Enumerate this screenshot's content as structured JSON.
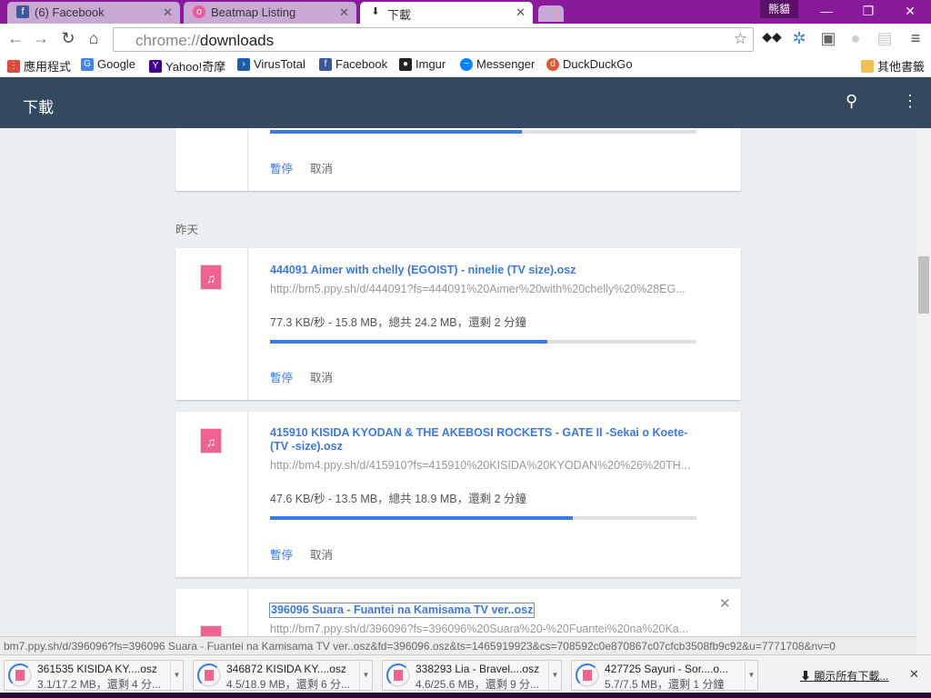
{
  "tabs": [
    {
      "label": "(6) Facebook",
      "icon": "facebook-icon"
    },
    {
      "label": "Beatmap Listing",
      "icon": "osu-icon"
    },
    {
      "label": "下載",
      "icon": "download-icon",
      "active": true
    }
  ],
  "profile": "熊貓",
  "omnibox": {
    "scheme": "chrome://",
    "path": "downloads"
  },
  "bookmarks": [
    "應用程式",
    "Google",
    "Yahoo!奇摩",
    "VirusTotal",
    "Facebook",
    "Imgur",
    "Messenger",
    "DuckDuckGo"
  ],
  "other_bookmarks": "其他書籤",
  "header": {
    "title": "下載"
  },
  "date_label": "昨天",
  "actions": {
    "pause": "暫停",
    "cancel": "取消"
  },
  "downloads": [
    {
      "progress": 0.59
    },
    {
      "name": "444091 Aimer with chelly (EGOIST) - ninelie (TV size).osz",
      "url": "http://bm5.ppy.sh/d/444091?fs=444091%20Aimer%20with%20chelly%20%28EG...",
      "desc": "77.3 KB/秒 - 15.8 MB，總共 24.2 MB，還剩 2 分鐘",
      "progress": 0.65
    },
    {
      "name": "415910 KISIDA KYODAN & THE AKEBOSI ROCKETS - GATE II -Sekai o Koete- (TV -size).osz",
      "url": "http://bm4.ppy.sh/d/415910?fs=415910%20KISIDA%20KYODAN%20%26%20TH...",
      "desc": "47.6 KB/秒 - 13.5 MB，總共 18.9 MB，還剩 2 分鐘",
      "progress": 0.71
    },
    {
      "name": "396096 Suara - Fuantei na Kamisama TV ver..osz",
      "url": "http://bm7.ppy.sh/d/396096?fs=396096%20Suara%20-%20Fuantei%20na%20Ka..."
    }
  ],
  "status_url": "bm7.ppy.sh/d/396096?fs=396096 Suara - Fuantei na Kamisama TV ver..osz&fd=396096.osz&ts=1465919923&cs=708592c0e870867c07cfcb3508fb9c92&u=7771708&nv=0",
  "shelf": [
    {
      "name": "361535 KISIDA KY....osz",
      "status": "3.1/17.2 MB，還剩 4 分..."
    },
    {
      "name": "346872 KISIDA KY....osz",
      "status": "4.5/18.9 MB，還剩 6 分..."
    },
    {
      "name": "338293 Lia - Bravel....osz",
      "status": "4.6/25.6 MB，還剩 9 分..."
    },
    {
      "name": "427725 Sayuri - Sor....o...",
      "status": "5.7/7.5 MB，還剩 1 分鐘"
    }
  ],
  "show_all": "顯示所有下載..."
}
